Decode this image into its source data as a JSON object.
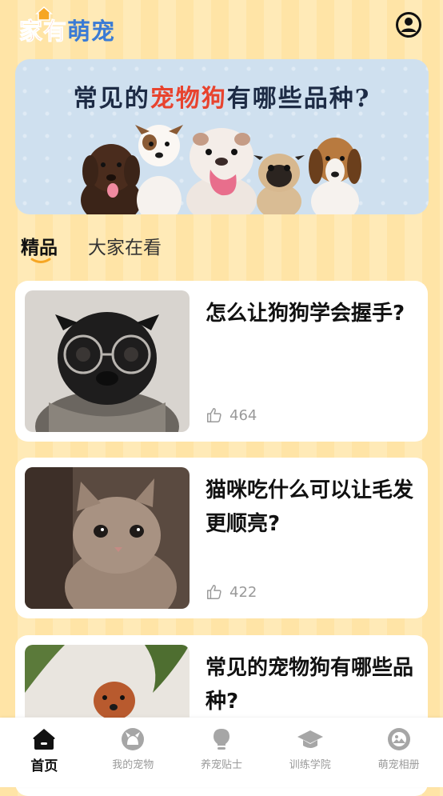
{
  "app": {
    "logo_part1": "家有",
    "logo_part2": "萌宠"
  },
  "banner": {
    "title_pre": "常见的",
    "title_highlight": "宠物狗",
    "title_post": "有哪些品种?"
  },
  "tabs": [
    {
      "label": "精品",
      "active": true
    },
    {
      "label": "大家在看",
      "active": false
    }
  ],
  "articles": [
    {
      "title": "怎么让狗狗学会握手?",
      "likes": "464",
      "image": "pug-with-glasses"
    },
    {
      "title": "猫咪吃什么可以让毛发更顺亮?",
      "likes": "422",
      "image": "kitten"
    },
    {
      "title": "常见的宠物狗有哪些品种?",
      "likes": "",
      "image": "poodle-on-bed"
    }
  ],
  "tabbar": {
    "items": [
      {
        "label": "首页",
        "icon": "home-icon",
        "active": true
      },
      {
        "label": "我的宠物",
        "icon": "pet-icon",
        "active": false
      },
      {
        "label": "养宠贴士",
        "icon": "bulb-icon",
        "active": false
      },
      {
        "label": "训练学院",
        "icon": "graduation-cap-icon",
        "active": false
      },
      {
        "label": "萌宠相册",
        "icon": "album-icon",
        "active": false
      }
    ]
  },
  "colors": {
    "accent": "#f6a623",
    "highlight": "#e8432e",
    "background": "#ffe4a6"
  }
}
